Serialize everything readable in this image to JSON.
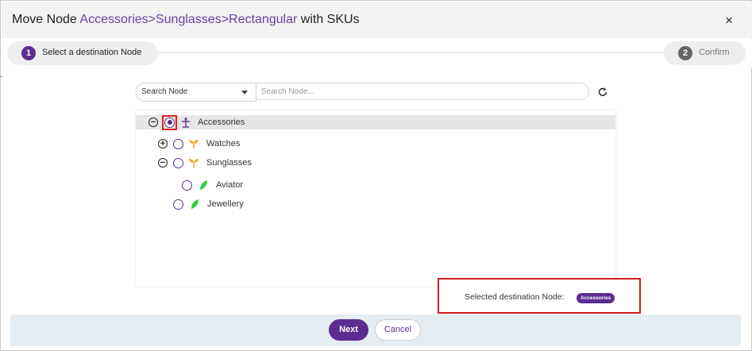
{
  "dialog": {
    "title_prefix": "Move Node",
    "title_path": "Accessories>Sunglasses>Rectangular",
    "title_suffix": "with SKUs",
    "close_label": "×"
  },
  "steps": [
    {
      "number": "1",
      "label": "Select a destination Node",
      "active": true
    },
    {
      "number": "2",
      "label": "Confirm",
      "active": false
    }
  ],
  "search": {
    "mode_value": "Search Node",
    "placeholder": "Search Node..."
  },
  "tree": {
    "toggle_expanded": "−",
    "toggle_collapsed": "+",
    "nodes": [
      {
        "label": "Accessories",
        "icon": "category-root-icon",
        "expanded": true,
        "selected": true
      },
      {
        "label": "Watches",
        "icon": "sprout-icon",
        "expanded": false,
        "selected": false
      },
      {
        "label": "Sunglasses",
        "icon": "sprout-icon",
        "expanded": true,
        "selected": false
      },
      {
        "label": "Aviator",
        "icon": "leaf-icon",
        "selected": false
      },
      {
        "label": "Jewellery",
        "icon": "leaf-icon",
        "selected": false
      }
    ]
  },
  "selection": {
    "label": "Selected destination Node:",
    "value": "Accessories"
  },
  "buttons": {
    "next": "Next",
    "cancel": "Cancel"
  },
  "colors": {
    "accent": "#5c2d91",
    "highlight": "#e02020",
    "sprout": "#f5a623",
    "leaf": "#2ecc40"
  }
}
